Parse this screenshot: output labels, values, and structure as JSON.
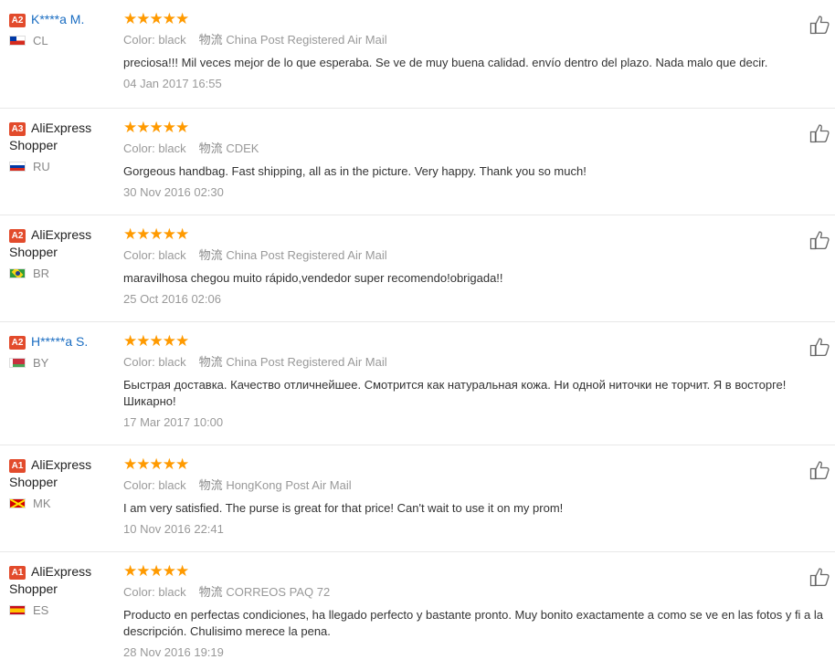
{
  "reviews": [
    {
      "level": "A2",
      "name_lines": [
        "K****a M."
      ],
      "masked": true,
      "country_code": "CL",
      "stars": 5,
      "color_label": "Color:",
      "color_value": "black",
      "ship_label": "物流",
      "ship_value": "China Post Registered Air Mail",
      "feedback": "preciosa!!! Mil veces mejor de lo que esperaba. Se ve de muy buena calidad. envío dentro del plazo. Nada malo que decir.",
      "date": "04 Jan 2017 16:55"
    },
    {
      "level": "A3",
      "name_lines": [
        "AliExpress",
        "Shopper"
      ],
      "masked": false,
      "country_code": "RU",
      "stars": 5,
      "color_label": "Color:",
      "color_value": "black",
      "ship_label": "物流",
      "ship_value": "CDEK",
      "feedback": "Gorgeous handbag. Fast shipping, all as in the picture. Very happy. Thank you so much!",
      "date": "30 Nov 2016 02:30"
    },
    {
      "level": "A2",
      "name_lines": [
        "AliExpress",
        "Shopper"
      ],
      "masked": false,
      "country_code": "BR",
      "stars": 5,
      "color_label": "Color:",
      "color_value": "black",
      "ship_label": "物流",
      "ship_value": "China Post Registered Air Mail",
      "feedback": "maravilhosa chegou muito rápido,vendedor super recomendo!obrigada!!",
      "date": "25 Oct 2016 02:06"
    },
    {
      "level": "A2",
      "name_lines": [
        "H*****a S."
      ],
      "masked": true,
      "country_code": "BY",
      "stars": 5,
      "color_label": "Color:",
      "color_value": "black",
      "ship_label": "物流",
      "ship_value": "China Post Registered Air Mail",
      "feedback": "Быстрая доставка. Качество отличнейшее. Смотрится как натуральная кожа. Ни одной ниточки не торчит. Я в восторге! Шикарно!",
      "date": "17 Mar 2017 10:00"
    },
    {
      "level": "A1",
      "name_lines": [
        "AliExpress",
        "Shopper"
      ],
      "masked": false,
      "country_code": "MK",
      "stars": 5,
      "color_label": "Color:",
      "color_value": "black",
      "ship_label": "物流",
      "ship_value": "HongKong Post Air Mail",
      "feedback": "I am very satisfied. The purse is great for that price! Can't wait to use it on my prom!",
      "date": "10 Nov 2016 22:41"
    },
    {
      "level": "A1",
      "name_lines": [
        "AliExpress",
        "Shopper"
      ],
      "masked": false,
      "country_code": "ES",
      "stars": 5,
      "color_label": "Color:",
      "color_value": "black",
      "ship_label": "物流",
      "ship_value": "CORREOS PAQ 72",
      "feedback": "Producto en perfectas condiciones, ha llegado perfecto y bastante pronto. Muy bonito exactamente a como se ve en las fotos y fi a la descripción. Chulisimo merece la pena.",
      "date": "28 Nov 2016 19:19"
    }
  ],
  "colors": {
    "star": "#ff9a00",
    "badge": "#e24b2c",
    "masked_name": "#1a6dc2"
  }
}
